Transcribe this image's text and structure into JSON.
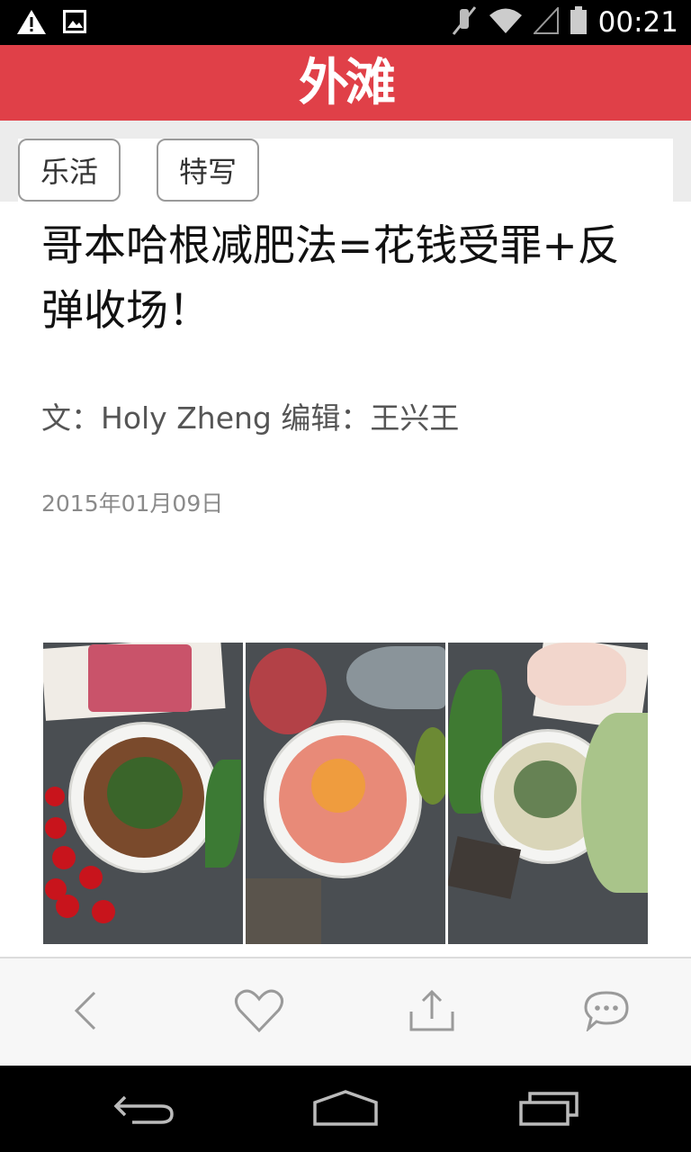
{
  "status_bar": {
    "time": "00:21",
    "icons": [
      "warning-icon",
      "image-icon",
      "mute-icon",
      "wifi-icon",
      "signal-icon",
      "battery-icon"
    ]
  },
  "header": {
    "logo_text": "外滩",
    "color": "#e04048"
  },
  "tags": [
    "乐活",
    "特写"
  ],
  "article": {
    "title": "哥本哈根减肥法=花钱受罪+反弹收场！",
    "byline": "文：Holy Zheng 编辑：王兴王",
    "date": "2015年01月09日"
  },
  "action_bar": {
    "icons": [
      "back-icon",
      "heart-icon",
      "share-icon",
      "comment-icon"
    ]
  },
  "nav_bar": {
    "icons": [
      "nav-back-icon",
      "nav-home-icon",
      "nav-recents-icon"
    ]
  }
}
